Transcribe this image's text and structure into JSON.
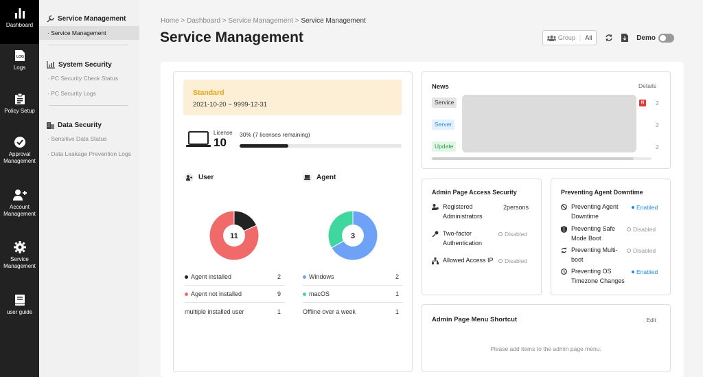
{
  "rail": {
    "items": [
      {
        "label": "Dashboard",
        "icon": "bar-chart-icon"
      },
      {
        "label": "Logs",
        "icon": "log-file-icon"
      },
      {
        "label": "Policy Setup",
        "icon": "clipboard-icon"
      },
      {
        "label": "Approval Management",
        "icon": "check-circle-icon"
      },
      {
        "label": "Account Management",
        "icon": "user-plus-icon"
      },
      {
        "label": "Service Management",
        "icon": "gear-icon"
      },
      {
        "label": "user guide",
        "icon": "book-icon"
      }
    ]
  },
  "subnav": {
    "sections": [
      {
        "title": "Service Management",
        "icon": "wrench-icon",
        "items": [
          "Service Management"
        ]
      },
      {
        "title": "System Security",
        "icon": "chart-icon",
        "items": [
          "PC Security Check Status",
          "PC Security Logs"
        ]
      },
      {
        "title": "Data Security",
        "icon": "building-icon",
        "items": [
          "Sensitive Data Status",
          "Data Leakage Prevention Logs"
        ]
      }
    ]
  },
  "breadcrumb": [
    "Home",
    "Dashboard",
    "Service Management",
    "Service Management"
  ],
  "page_title": "Service Management",
  "toolbar": {
    "group_label": "Group",
    "group_value": "All",
    "demo_label": "Demo",
    "demo_on": false
  },
  "license": {
    "plan": "Standard",
    "dates": "2021-10-20 ~ 9999-12-31",
    "label": "License",
    "count": "10",
    "remaining_text": "30% (7 licenses remaining)",
    "used_fraction": 0.3
  },
  "user_panel": {
    "title": "User",
    "total": "11",
    "rows": [
      {
        "label": "Agent installed",
        "value": "2",
        "color": "#222222"
      },
      {
        "label": "Agent not installed",
        "value": "9",
        "color": "#f06a6a"
      },
      {
        "label": "multiple installed user",
        "value": "1",
        "color": ""
      }
    ]
  },
  "agent_panel": {
    "title": "Agent",
    "total": "3",
    "rows": [
      {
        "label": "Windows",
        "value": "2",
        "color": "#6ea2f6"
      },
      {
        "label": "macOS",
        "value": "1",
        "color": "#3fd6a0"
      },
      {
        "label": "Offline over a week",
        "value": "1",
        "color": ""
      }
    ]
  },
  "news": {
    "title": "News",
    "details_label": "Details",
    "tags": [
      {
        "label": "Service",
        "bg": "#e4e4e4",
        "fg": "#333333"
      },
      {
        "label": "Server",
        "bg": "#e3f0fd",
        "fg": "#2b86e6"
      },
      {
        "label": "Update",
        "bg": "#e2f6e7",
        "fg": "#2e9b47"
      }
    ],
    "new_badge": "N",
    "date_fragment": "2"
  },
  "access_security": {
    "title": "Admin Page Access Security",
    "rows": [
      {
        "label": "Registered Administrators",
        "value": "2persons",
        "icon": "user-gear-icon",
        "state": "text"
      },
      {
        "label": "Two-factor Authentication",
        "value": "Disabled",
        "icon": "key-icon",
        "state": "off"
      },
      {
        "label": "Allowed Access IP",
        "value": "Disabled",
        "icon": "network-icon",
        "state": "off"
      }
    ]
  },
  "downtime": {
    "title": "Preventing Agent Downtime",
    "rows": [
      {
        "label": "Preventing Agent Downtime",
        "value": "Enabled",
        "icon": "block-icon",
        "state": "on"
      },
      {
        "label": "Preventing Safe Mode Boot",
        "value": "Disabled",
        "icon": "shield-icon",
        "state": "off"
      },
      {
        "label": "Preventing Multi-boot",
        "value": "Disabled",
        "icon": "refresh-icon",
        "state": "off"
      },
      {
        "label": "Preventing OS Timezone Changes",
        "value": "Enabled",
        "icon": "clock-icon",
        "state": "on"
      }
    ]
  },
  "shortcut": {
    "title": "Admin Page Menu Shortcut",
    "edit_label": "Edit",
    "empty_text": "Please add items to the admin page menu."
  },
  "colors": {
    "accent": "#1e88e5",
    "plan": "#e8a11b",
    "user_installed": "#222222",
    "user_not_installed": "#f06a6a",
    "windows": "#6ea2f6",
    "macos": "#3fd6a0"
  }
}
